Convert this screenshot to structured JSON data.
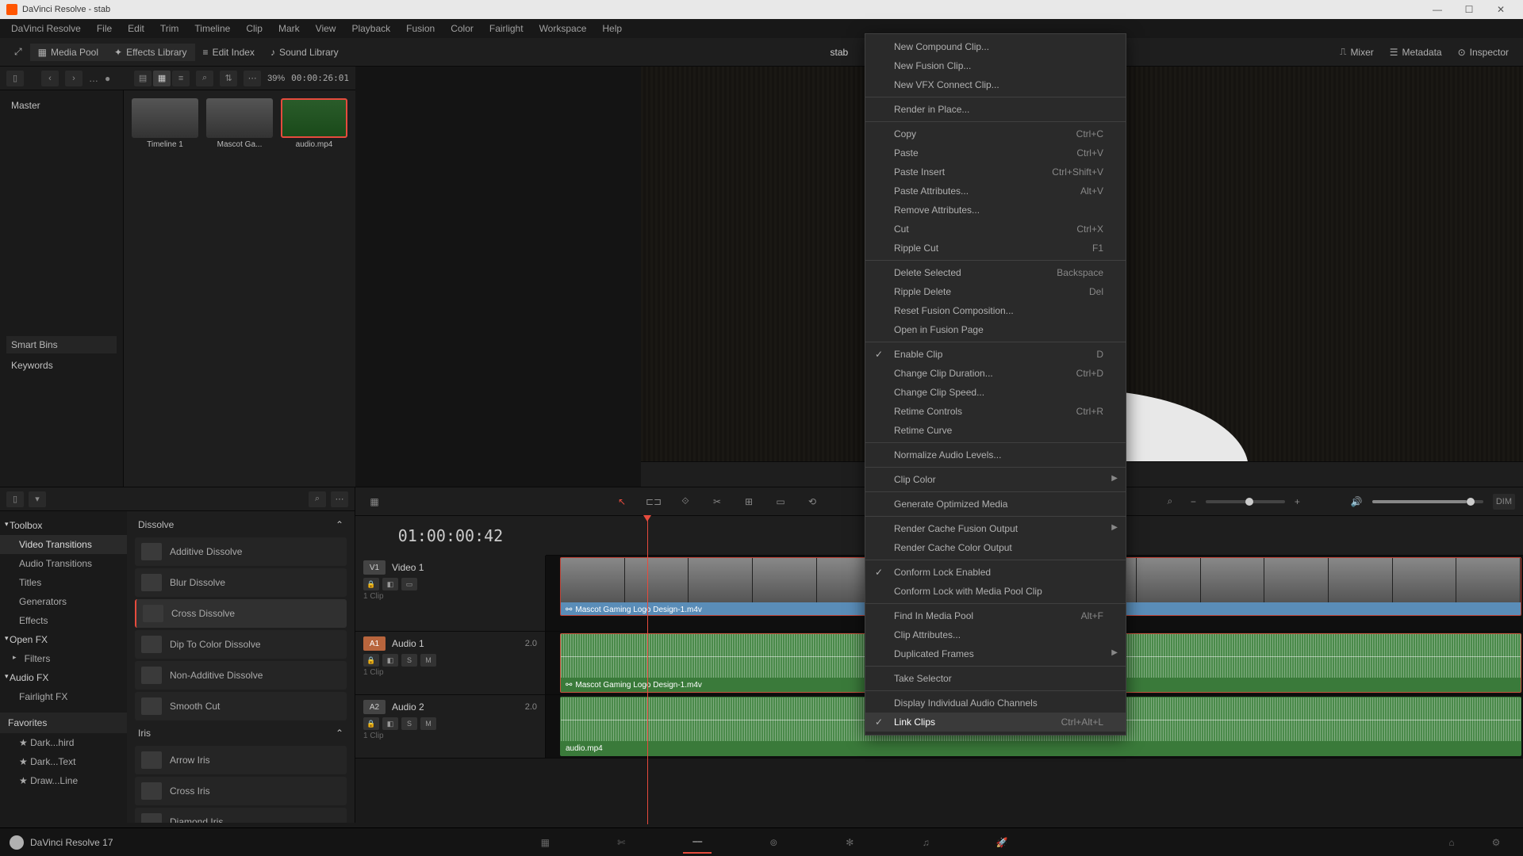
{
  "window": {
    "title": "DaVinci Resolve - stab"
  },
  "menubar": [
    "DaVinci Resolve",
    "File",
    "Edit",
    "Trim",
    "Timeline",
    "Clip",
    "Mark",
    "View",
    "Playback",
    "Fusion",
    "Color",
    "Fairlight",
    "Workspace",
    "Help"
  ],
  "toolbar": {
    "media_pool": "Media Pool",
    "effects_library": "Effects Library",
    "edit_index": "Edit Index",
    "sound_library": "Sound Library",
    "mixer": "Mixer",
    "metadata": "Metadata",
    "inspector": "Inspector",
    "title": "stab"
  },
  "pool_header": {
    "zoom": "39%",
    "timecode": "00:00:26:01"
  },
  "viewer": {
    "timecode": "01:00:00:42"
  },
  "media_tree": {
    "root": "Master",
    "smart_bins": "Smart Bins",
    "keywords": "Keywords"
  },
  "clips": [
    {
      "name": "Timeline 1"
    },
    {
      "name": "Mascot Ga..."
    },
    {
      "name": "audio.mp4"
    }
  ],
  "context_menu": [
    {
      "label": "New Compound Clip..."
    },
    {
      "label": "New Fusion Clip..."
    },
    {
      "label": "New VFX Connect Clip..."
    },
    {
      "sep": true
    },
    {
      "label": "Render in Place..."
    },
    {
      "sep": true
    },
    {
      "label": "Copy",
      "shortcut": "Ctrl+C"
    },
    {
      "label": "Paste",
      "shortcut": "Ctrl+V"
    },
    {
      "label": "Paste Insert",
      "shortcut": "Ctrl+Shift+V"
    },
    {
      "label": "Paste Attributes...",
      "shortcut": "Alt+V"
    },
    {
      "label": "Remove Attributes..."
    },
    {
      "label": "Cut",
      "shortcut": "Ctrl+X"
    },
    {
      "label": "Ripple Cut",
      "shortcut": "F1"
    },
    {
      "sep": true
    },
    {
      "label": "Delete Selected",
      "shortcut": "Backspace"
    },
    {
      "label": "Ripple Delete",
      "shortcut": "Del"
    },
    {
      "label": "Reset Fusion Composition..."
    },
    {
      "label": "Open in Fusion Page"
    },
    {
      "sep": true
    },
    {
      "label": "Enable Clip",
      "shortcut": "D",
      "checked": true
    },
    {
      "label": "Change Clip Duration...",
      "shortcut": "Ctrl+D"
    },
    {
      "label": "Change Clip Speed..."
    },
    {
      "label": "Retime Controls",
      "shortcut": "Ctrl+R"
    },
    {
      "label": "Retime Curve"
    },
    {
      "sep": true
    },
    {
      "label": "Normalize Audio Levels..."
    },
    {
      "sep": true
    },
    {
      "label": "Clip Color",
      "submenu": true
    },
    {
      "sep": true
    },
    {
      "label": "Generate Optimized Media"
    },
    {
      "sep": true
    },
    {
      "label": "Render Cache Fusion Output",
      "submenu": true
    },
    {
      "label": "Render Cache Color Output"
    },
    {
      "sep": true
    },
    {
      "label": "Conform Lock Enabled",
      "checked": true
    },
    {
      "label": "Conform Lock with Media Pool Clip"
    },
    {
      "sep": true
    },
    {
      "label": "Find In Media Pool",
      "shortcut": "Alt+F"
    },
    {
      "label": "Clip Attributes..."
    },
    {
      "label": "Duplicated Frames",
      "submenu": true
    },
    {
      "sep": true
    },
    {
      "label": "Take Selector"
    },
    {
      "sep": true
    },
    {
      "label": "Display Individual Audio Channels"
    },
    {
      "label": "Link Clips",
      "shortcut": "Ctrl+Alt+L",
      "checked": true,
      "hover": true
    }
  ],
  "fx_tree": {
    "toolbox": "Toolbox",
    "video_transitions": "Video Transitions",
    "audio_transitions": "Audio Transitions",
    "titles": "Titles",
    "generators": "Generators",
    "effects": "Effects",
    "openfx": "Open FX",
    "filters": "Filters",
    "audiofx": "Audio FX",
    "fairlightfx": "Fairlight FX",
    "favorites": "Favorites"
  },
  "fx_list": {
    "cat1": "Dissolve",
    "items1": [
      "Additive Dissolve",
      "Blur Dissolve",
      "Cross Dissolve",
      "Dip To Color Dissolve",
      "Non-Additive Dissolve",
      "Smooth Cut"
    ],
    "cat2": "Iris",
    "items2": [
      "Arrow Iris",
      "Cross Iris",
      "Diamond Iris"
    ]
  },
  "favorites_items": [
    "Dark...hird",
    "Dark...Text",
    "Draw...Line"
  ],
  "timeline": {
    "timecode": "01:00:00:42",
    "dim": "DIM",
    "tracks": [
      {
        "tag": "V1",
        "name": "Video 1",
        "clips": "1 Clip",
        "clip_label": "Mascot Gaming Logo Design-1.m4v"
      },
      {
        "tag": "A1",
        "name": "Audio 1",
        "chan": "2.0",
        "clips": "1 Clip",
        "clip_label": "Mascot Gaming Logo Design-1.m4v",
        "dest": true
      },
      {
        "tag": "A2",
        "name": "Audio 2",
        "chan": "2.0",
        "clips": "1 Clip",
        "clip_label": "audio.mp4"
      }
    ]
  },
  "footer": {
    "app": "DaVinci Resolve 17"
  }
}
